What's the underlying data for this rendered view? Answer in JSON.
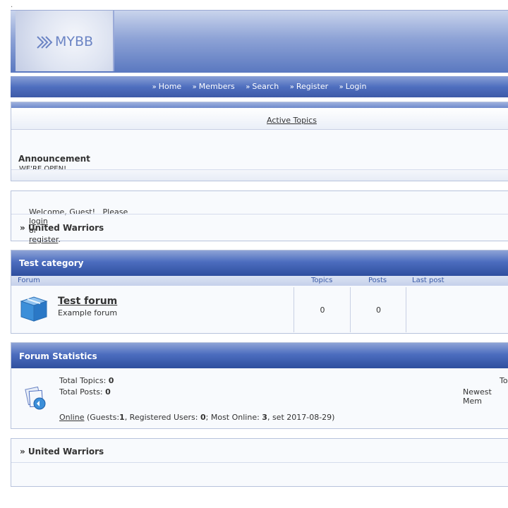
{
  "page": {
    "top_dot": "."
  },
  "header": {
    "logo_text": "MYBB"
  },
  "nav": {
    "items": [
      {
        "label": "Home"
      },
      {
        "label": "Members"
      },
      {
        "label": "Search"
      },
      {
        "label": "Register"
      },
      {
        "label": "Login"
      }
    ]
  },
  "announcement_panel": {
    "active_topics_label": "Active Topics",
    "title": "Announcement",
    "text": "WE'RE OPEN!"
  },
  "welcome_panel": {
    "prefix": "Welcome, Guest!   Please",
    "login_label": "login",
    "or": "or",
    "register_label": "register",
    "period": ".",
    "breadcrumb": "» United Warriors"
  },
  "category": {
    "title": "Test category",
    "columns": {
      "forum": "Forum",
      "topics": "Topics",
      "posts": "Posts",
      "last_post": "Last post"
    },
    "forums": [
      {
        "name": "Test forum",
        "description": "Example forum",
        "topics": "0",
        "posts": "0",
        "last_post": ""
      }
    ]
  },
  "stats": {
    "title": "Forum Statistics",
    "total_topics_label": "Total Topics:",
    "total_topics_value": "0",
    "total_posts_label": "Total Posts:",
    "total_posts_value": "0",
    "right_top": "To",
    "right_bottom": "Newest Mem",
    "online_label": "Online",
    "online_open": "(Guests:",
    "guests": "1",
    "reg_label": ", Registered Users:",
    "registered": "0",
    "most_label": "; Most Online:",
    "most": "3",
    "most_date": ", set 2017-08-29)"
  },
  "footer_panel": {
    "breadcrumb": "» United Warriors"
  },
  "colors": {
    "accent": "#3d5aa8",
    "panel_bg": "#f8fafd",
    "border": "#b8c3dc"
  }
}
